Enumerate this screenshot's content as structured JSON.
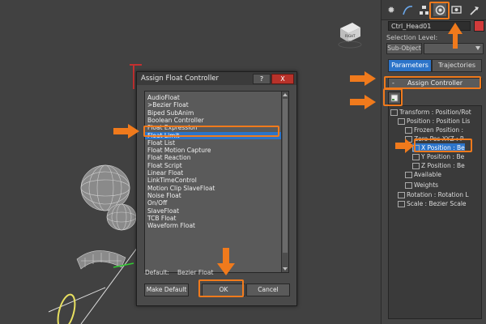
{
  "dialog": {
    "title": "Assign Float Controller",
    "help_label": "?",
    "close_label": "X",
    "list_items": [
      "AudioFloat",
      ">Bezier Float",
      "Biped SubAnim",
      "Boolean Controller",
      "Float Expression",
      "Float Limit",
      "Float List",
      "Float Motion Capture",
      "Float Reaction",
      "Float Script",
      "Linear Float",
      "LinkTimeControl",
      "Motion Clip SlaveFloat",
      "Noise Float",
      "On/Off",
      "SlaveFloat",
      "TCB Float",
      "Waveform Float"
    ],
    "selected_index": 5,
    "default_label": "Default:",
    "default_value": "Bezier Float",
    "make_default_label": "Make Default",
    "ok_label": "OK",
    "cancel_label": "Cancel"
  },
  "panel": {
    "object_name": "Ctrl_Head01",
    "selection_level_label": "Selection Level:",
    "sub_object_label": "Sub-Object",
    "parameters_tab": "Parameters",
    "trajectories_tab": "Trajectories",
    "rollout_minus": "-",
    "rollout_title": "Assign Controller",
    "tree": [
      {
        "text": "Transform : Position/Rot",
        "indent": 0,
        "selected": false
      },
      {
        "text": "Position : Position Lis",
        "indent": 1,
        "selected": false
      },
      {
        "text": "Frozen Position : ",
        "indent": 2,
        "selected": false
      },
      {
        "text": "Zero Pos XYZ : P",
        "indent": 2,
        "selected": false
      },
      {
        "text": "X Position : Be",
        "indent": 3,
        "selected": true
      },
      {
        "text": "Y Position : Be",
        "indent": 3,
        "selected": false
      },
      {
        "text": "Z Position : Be",
        "indent": 3,
        "selected": false
      },
      {
        "text": "Available",
        "indent": 2,
        "selected": false
      },
      {
        "text": "Weights",
        "indent": 2,
        "selected": false
      },
      {
        "text": "Rotation : Rotation L",
        "indent": 1,
        "selected": false
      },
      {
        "text": "Scale : Bezier Scale",
        "indent": 1,
        "selected": false
      }
    ]
  },
  "tabs": [
    "sun-icon",
    "curve-icon",
    "hierarchy-icon",
    "motion-icon",
    "display-icon",
    "hammer-icon"
  ],
  "viewport_cube_label": "RIGHT",
  "colors": {
    "accent": "#2c74c9",
    "highlight": "#f07a1c",
    "object_color": "#d23b3b"
  }
}
